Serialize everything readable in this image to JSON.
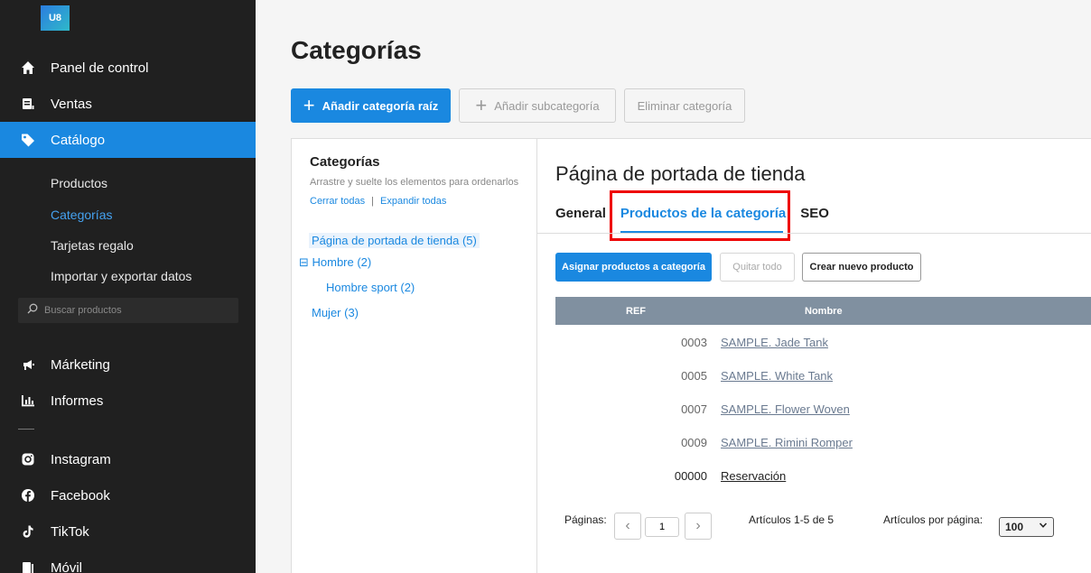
{
  "logo": {
    "text": "U8"
  },
  "sidebar": {
    "items": [
      {
        "label": "Panel de control",
        "icon": "home-icon"
      },
      {
        "label": "Ventas",
        "icon": "sales-icon"
      },
      {
        "label": "Catálogo",
        "icon": "tag-icon"
      },
      {
        "label": "Márketing",
        "icon": "megaphone-icon"
      },
      {
        "label": "Informes",
        "icon": "chart-icon"
      },
      {
        "label": "Instagram",
        "icon": "instagram-icon"
      },
      {
        "label": "Facebook",
        "icon": "facebook-icon"
      },
      {
        "label": "TikTok",
        "icon": "tiktok-icon"
      },
      {
        "label": "Móvil",
        "icon": "mobile-icon"
      }
    ],
    "catalog_sub": [
      "Productos",
      "Categorías",
      "Tarjetas regalo",
      "Importar y exportar datos"
    ],
    "search_placeholder": "Buscar productos"
  },
  "page": {
    "title": "Categorías",
    "add_root_label": "Añadir categoría raíz",
    "add_sub_label": "Añadir subcategoría",
    "delete_label": "Eliminar categoría"
  },
  "tree": {
    "title": "Categorías",
    "hint": "Arrastre y suelte los elementos para ordenarlos",
    "collapse_all": "Cerrar todas",
    "link_sep": "|",
    "expand_all": "Expandir todas",
    "nodes": [
      "Página de portada de tienda (5)",
      "⊟ Hombre (2)",
      "Hombre sport (2)",
      "Mujer (3)"
    ]
  },
  "detail": {
    "title": "Página de portada de tienda",
    "tabs": [
      "General",
      "Productos de la categoría",
      "SEO"
    ],
    "assign_label": "Asignar productos a categoría",
    "remove_all_label": "Quitar todo",
    "create_label": "Crear nuevo producto",
    "columns": [
      "REF",
      "Nombre"
    ],
    "rows": [
      {
        "ref": "0003",
        "name": "SAMPLE. Jade Tank"
      },
      {
        "ref": "0005",
        "name": "SAMPLE. White Tank"
      },
      {
        "ref": "0007",
        "name": "SAMPLE. Flower Woven"
      },
      {
        "ref": "0009",
        "name": "SAMPLE. Rimini Romper"
      },
      {
        "ref": "00000",
        "name": "Reservación"
      }
    ],
    "pages_label": "Páginas:",
    "page_value": "1",
    "items_info": "Artículos 1-5 de 5",
    "per_page_label": "Artículos por página:",
    "per_page_value": "100"
  },
  "colors": {
    "accent": "#1a88e0",
    "sidebar_bg": "#202020",
    "highlight_box": "#e00000"
  }
}
